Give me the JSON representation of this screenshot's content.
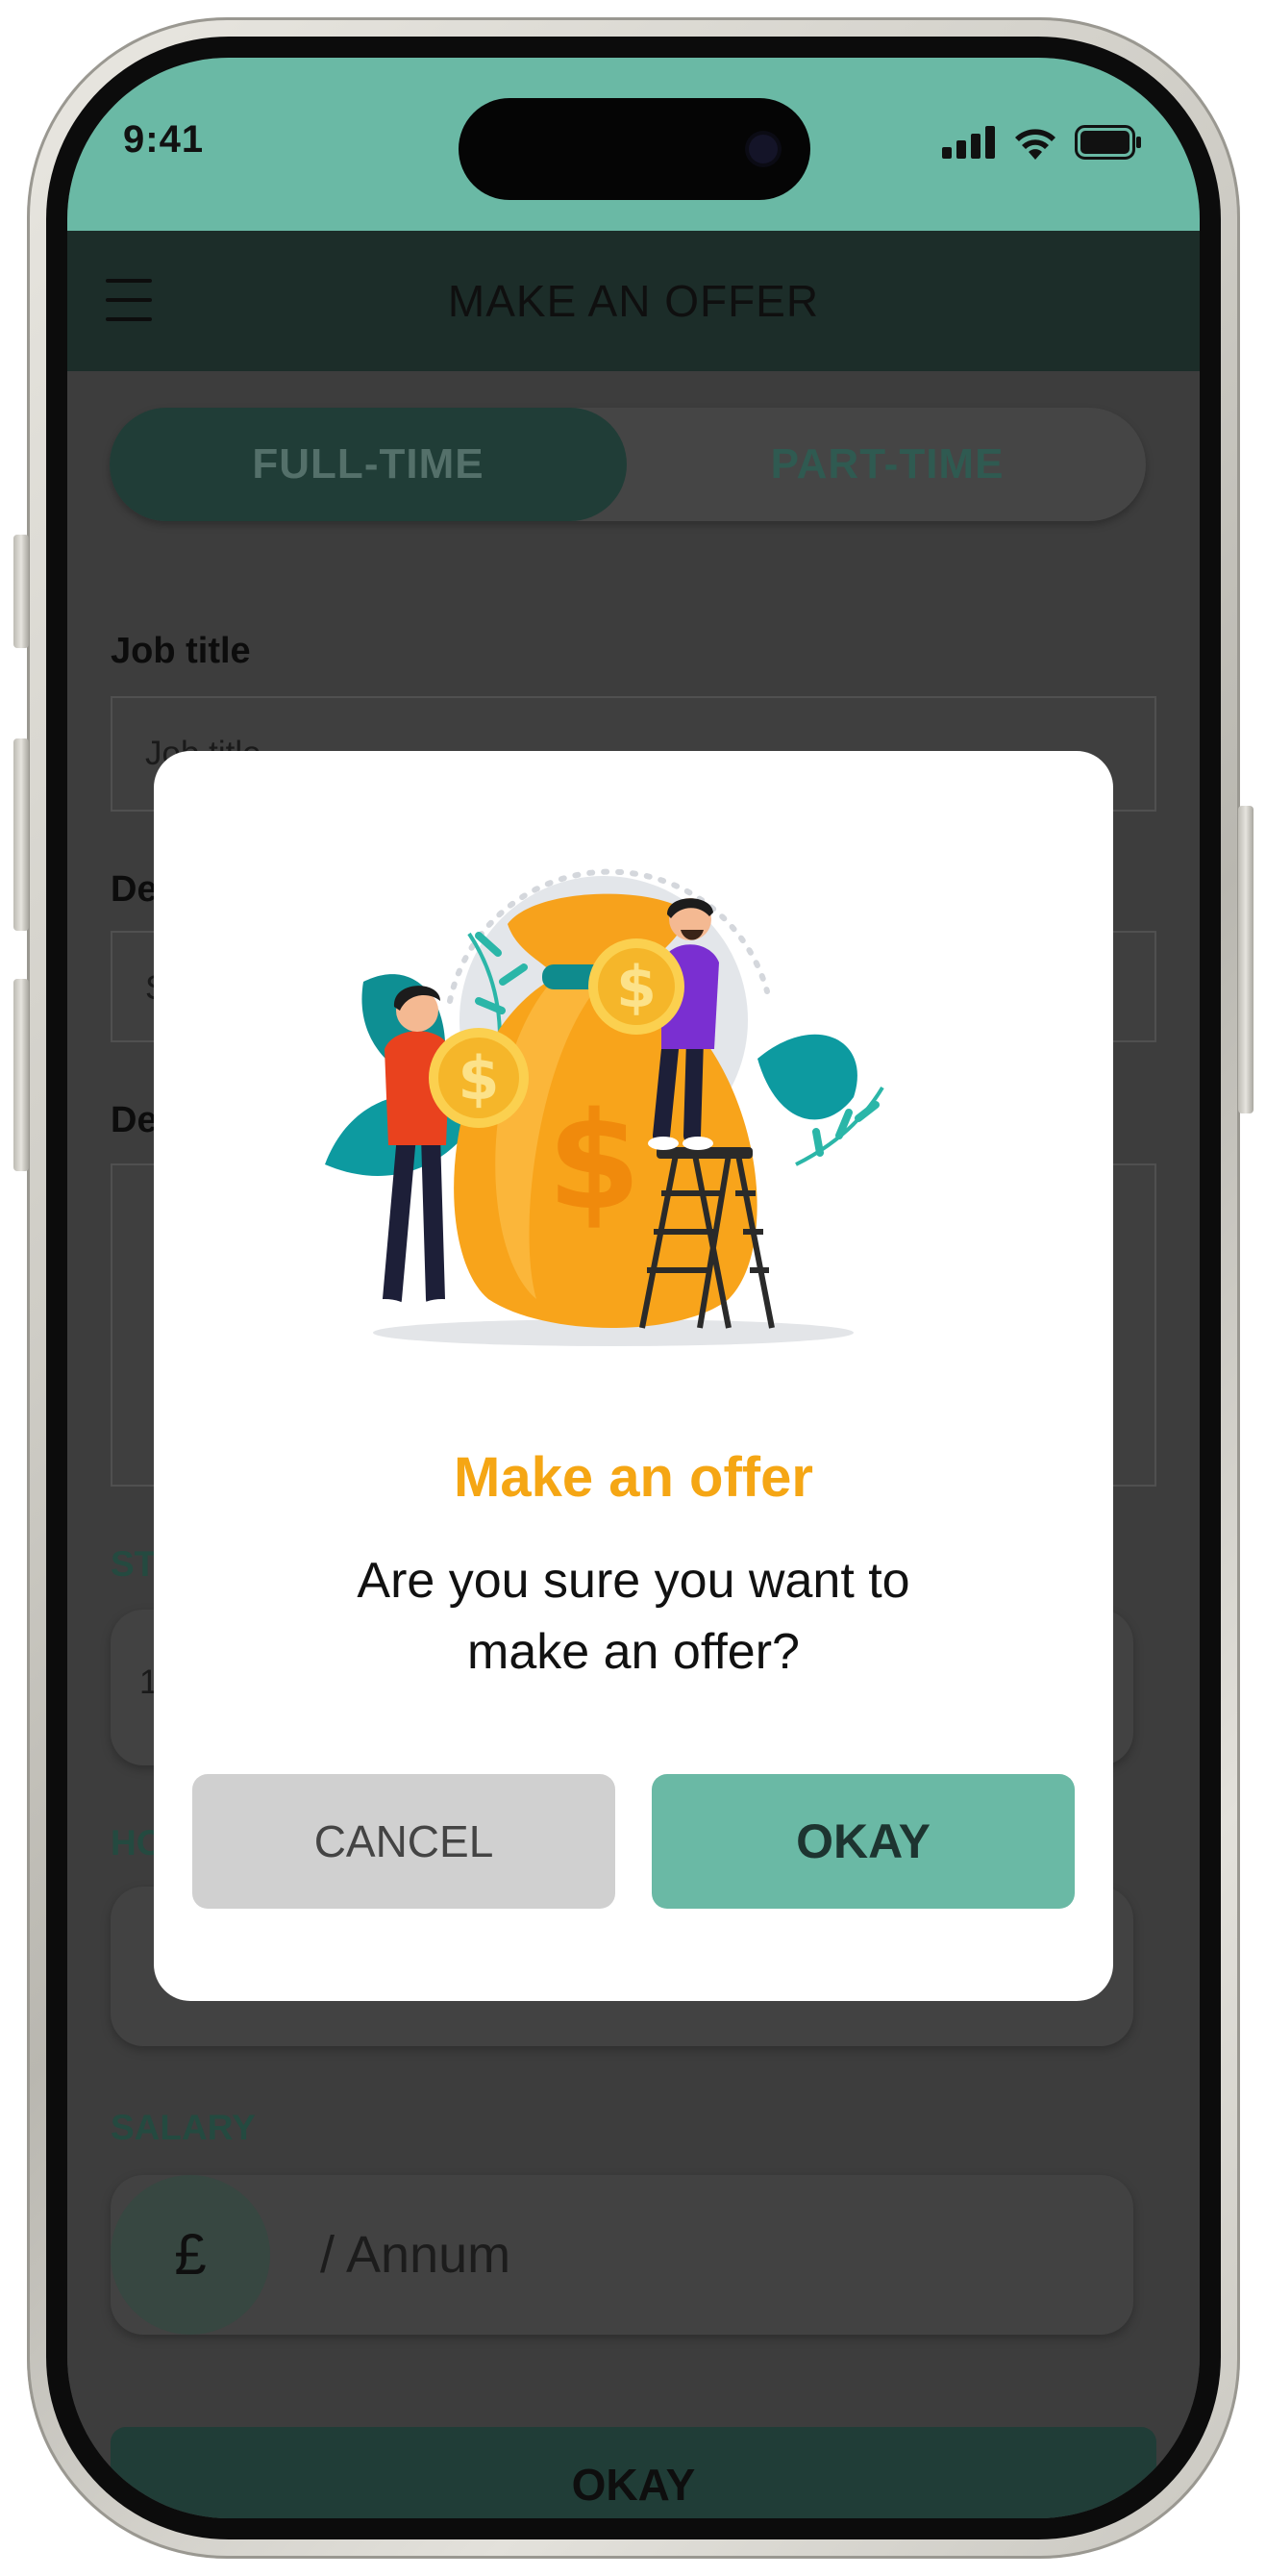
{
  "status_bar": {
    "time": "9:41"
  },
  "app_bar": {
    "title": "MAKE AN OFFER",
    "menu_icon": "hamburger-menu-icon"
  },
  "tabs": {
    "full_time": "FULL-TIME",
    "part_time": "PART-TIME",
    "active": "FULL-TIME"
  },
  "form": {
    "job_title_label": "Job title",
    "job_title_placeholder": "Job title",
    "label_2": "De",
    "field_2_text": "S",
    "label_3": "De",
    "field_3_text": "",
    "start_label": "ST",
    "start_value": "1",
    "hours_label": "HO",
    "salary_label": "SALARY",
    "currency_symbol": "£",
    "salary_suffix": "/ Annum",
    "okay_label": "OKAY"
  },
  "dialog": {
    "title": "Make an offer",
    "message": "Are you sure you want to make an offer?",
    "cancel_label": "CANCEL",
    "okay_label": "OKAY",
    "illustration": "money-bag-illustration"
  },
  "colors": {
    "accent": "#6ab9a5",
    "dark_green": "#203d37",
    "title_orange": "#f5a614",
    "cancel_gray": "#d0d0d0"
  }
}
